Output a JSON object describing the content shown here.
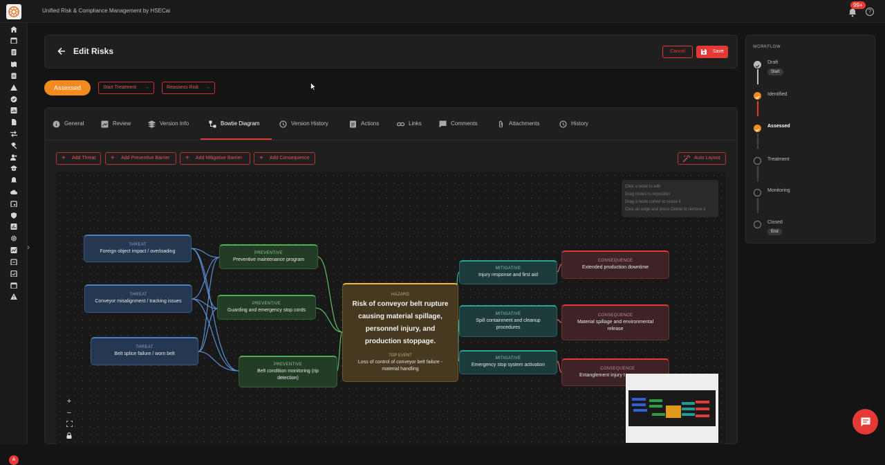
{
  "app": {
    "title": "Unified Risk & Compliance Management by HSECai",
    "notif_count": "99+",
    "avatar": "A"
  },
  "header": {
    "title": "Edit Risks",
    "cancel": "Cancel",
    "save": "Save"
  },
  "status": {
    "label": "Assessed",
    "start_treatment": "Start Treatment",
    "reassess": "Reassess Risk"
  },
  "tabs": [
    "General",
    "Review",
    "Version Info",
    "Bowtie Diagram",
    "Version History",
    "Actions",
    "Links",
    "Comments",
    "Attachments",
    "History"
  ],
  "active_tab": "Bowtie Diagram",
  "toolbar": {
    "add_threat": "Add Threat",
    "add_preventive": "Add Preventive Barrier",
    "add_mitigative": "Add Mitigative Barrier",
    "add_consequence": "Add Consequence",
    "auto_layout": "Auto Layout"
  },
  "hints": [
    "Click a node to edit",
    "Drag nodes to reposition",
    "Drag a node corner to resize it",
    "Click an edge and press Delete to remove it"
  ],
  "nodes": {
    "threats": [
      {
        "type": "THREAT",
        "label": "Foreign object impact / overloading"
      },
      {
        "type": "THREAT",
        "label": "Conveyor misalignment / tracking issues"
      },
      {
        "type": "THREAT",
        "label": "Belt splice failure / worn belt"
      }
    ],
    "preventive": [
      {
        "type": "PREVENTIVE",
        "label": "Preventive maintenance program"
      },
      {
        "type": "PREVENTIVE",
        "label": "Guarding and emergency stop cords"
      },
      {
        "type": "PREVENTIVE",
        "label": "Belt condition monitoring (rip detection)"
      }
    ],
    "hazard": {
      "type": "HAZARD",
      "title": "Risk of conveyor belt rupture causing material spillage, personnel injury, and production stoppage.",
      "te_type": "TOP EVENT",
      "te_label": "Loss of control of conveyor belt failure - material handling"
    },
    "mitigative": [
      {
        "type": "MITIGATIVE",
        "label": "Injury response and first aid"
      },
      {
        "type": "MITIGATIVE",
        "label": "Spill containment and cleanup procedures"
      },
      {
        "type": "MITIGATIVE",
        "label": "Emergency stop system activation"
      }
    ],
    "consequences": [
      {
        "type": "CONSEQUENCE",
        "label": "Extended production downtime"
      },
      {
        "type": "CONSEQUENCE",
        "label": "Material spillage and environmental release"
      },
      {
        "type": "CONSEQUENCE",
        "label": "Entanglement injury t"
      }
    ]
  },
  "workflow": {
    "title": "WORKFLOW",
    "steps": [
      {
        "label": "Draft",
        "chip": "Start"
      },
      {
        "label": "Identified"
      },
      {
        "label": "Assessed"
      },
      {
        "label": "Treatment"
      },
      {
        "label": "Monitoring"
      },
      {
        "label": "Closed",
        "chip": "End"
      }
    ]
  },
  "colors": {
    "accent": "#e53935",
    "status": "#f28a1e",
    "threat": "#4a7fc4",
    "preventive": "#4caf50",
    "hazard": "#f2b632",
    "mitigative": "#26a69a",
    "consequence": "#e53935"
  }
}
